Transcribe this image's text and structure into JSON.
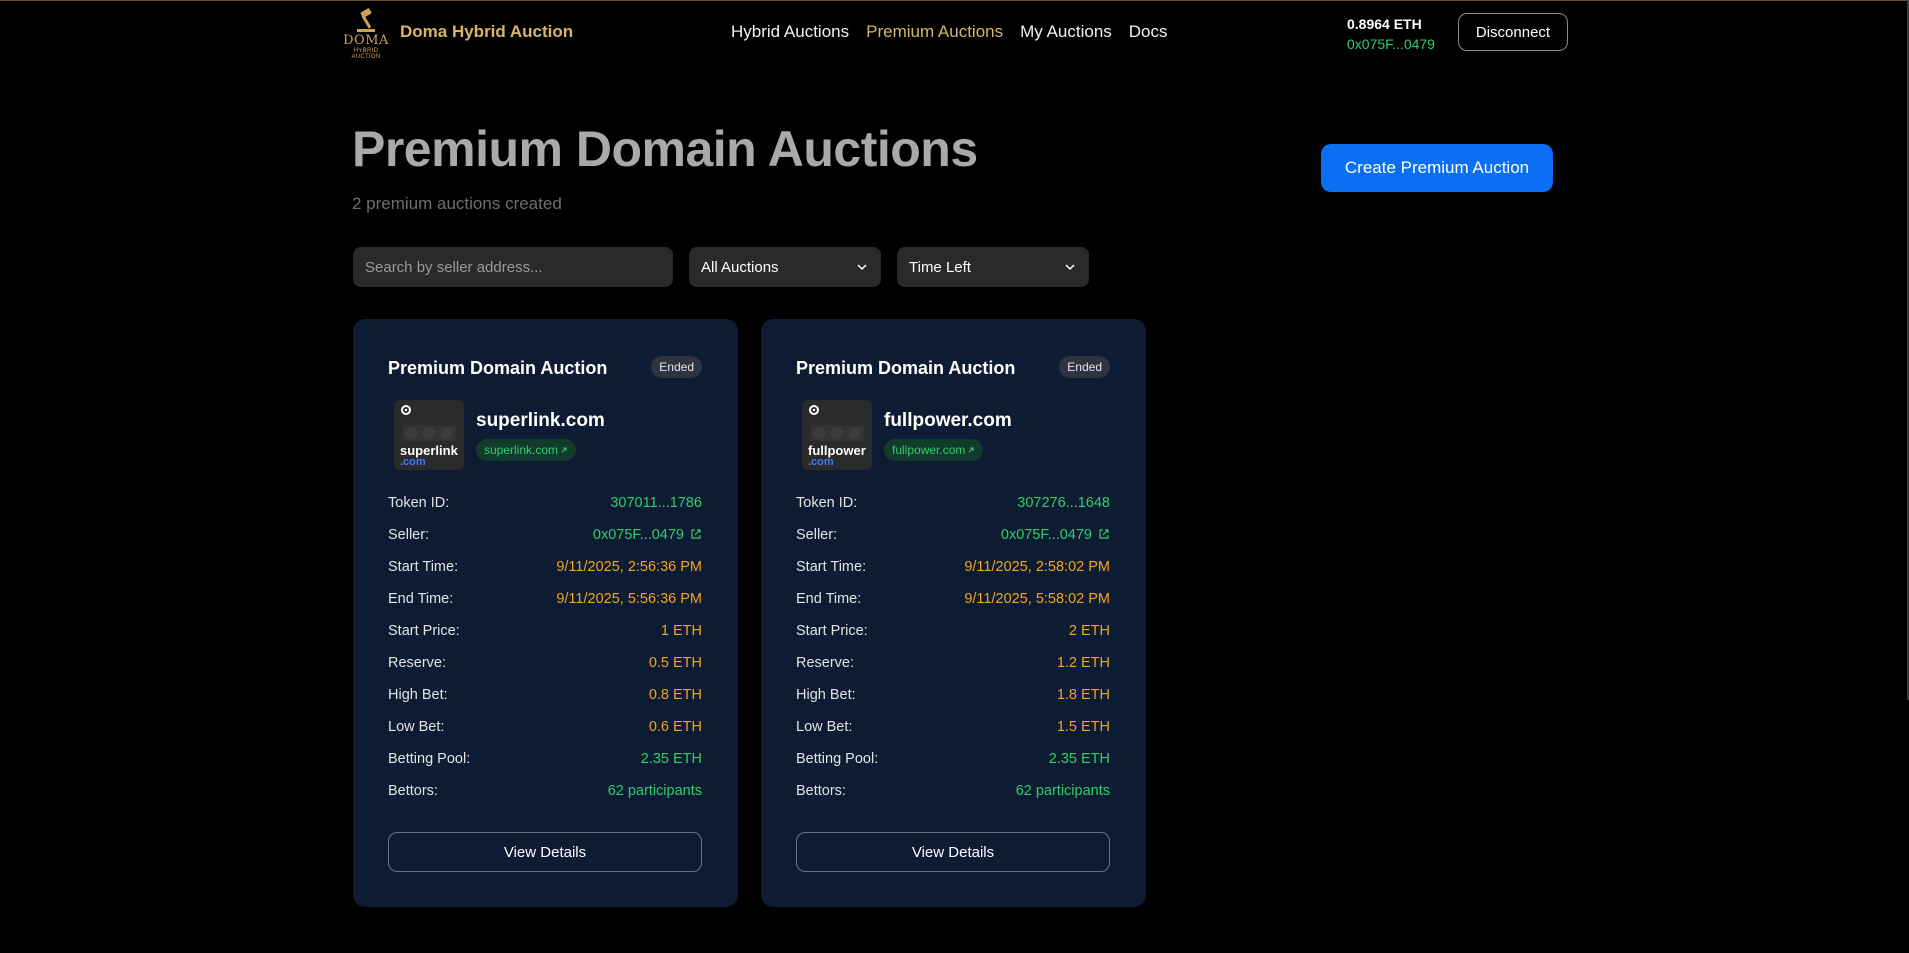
{
  "header": {
    "logo_word": "DOMA",
    "logo_sub": "HYBRID AUCTION",
    "brand": "Doma Hybrid Auction",
    "nav": [
      {
        "label": "Hybrid Auctions"
      },
      {
        "label": "Premium Auctions",
        "active": true
      },
      {
        "label": "My Auctions"
      },
      {
        "label": "Docs"
      }
    ],
    "balance": "0.8964 ETH",
    "address": "0x075F...0479",
    "disconnect": "Disconnect"
  },
  "page": {
    "title": "Premium Domain Auctions",
    "subtitle": "2 premium auctions created",
    "create_button": "Create Premium Auction"
  },
  "filters": {
    "search_placeholder": "Search by seller address...",
    "status_select": "All Auctions",
    "sort_select": "Time Left"
  },
  "cards": [
    {
      "title": "Premium Domain Auction",
      "status": "Ended",
      "thumb_name": "superlink",
      "thumb_tld": ".com",
      "domain": "superlink.com",
      "domain_link": "superlink.com",
      "rows": [
        {
          "label": "Token ID:",
          "value": "307011...1786"
        },
        {
          "label": "Seller:",
          "value": "0x075F...0479"
        },
        {
          "label": "Start Time:",
          "value": "9/11/2025, 2:56:36 PM"
        },
        {
          "label": "End Time:",
          "value": "9/11/2025, 5:56:36 PM"
        },
        {
          "label": "Start Price:",
          "value": "1 ETH"
        },
        {
          "label": "Reserve:",
          "value": "0.5 ETH"
        },
        {
          "label": "High Bet:",
          "value": "0.8 ETH"
        },
        {
          "label": "Low Bet:",
          "value": "0.6 ETH"
        },
        {
          "label": "Betting Pool:",
          "value": "2.35 ETH"
        },
        {
          "label": "Bettors:",
          "value": "62 participants"
        }
      ],
      "button": "View Details"
    },
    {
      "title": "Premium Domain Auction",
      "status": "Ended",
      "thumb_name": "fullpower",
      "thumb_tld": ".com",
      "domain": "fullpower.com",
      "domain_link": "fullpower.com",
      "rows": [
        {
          "label": "Token ID:",
          "value": "307276...1648"
        },
        {
          "label": "Seller:",
          "value": "0x075F...0479"
        },
        {
          "label": "Start Time:",
          "value": "9/11/2025, 2:58:02 PM"
        },
        {
          "label": "End Time:",
          "value": "9/11/2025, 5:58:02 PM"
        },
        {
          "label": "Start Price:",
          "value": "2 ETH"
        },
        {
          "label": "Reserve:",
          "value": "1.2 ETH"
        },
        {
          "label": "High Bet:",
          "value": "1.8 ETH"
        },
        {
          "label": "Low Bet:",
          "value": "1.5 ETH"
        },
        {
          "label": "Betting Pool:",
          "value": "2.35 ETH"
        },
        {
          "label": "Bettors:",
          "value": "62 participants"
        }
      ],
      "button": "View Details"
    }
  ],
  "colors": {
    "gold": "#d8b566",
    "green": "#2fce6c",
    "orange": "#f2a51a",
    "primary": "#0a6ff2",
    "card_bg": "#0d1b33"
  }
}
